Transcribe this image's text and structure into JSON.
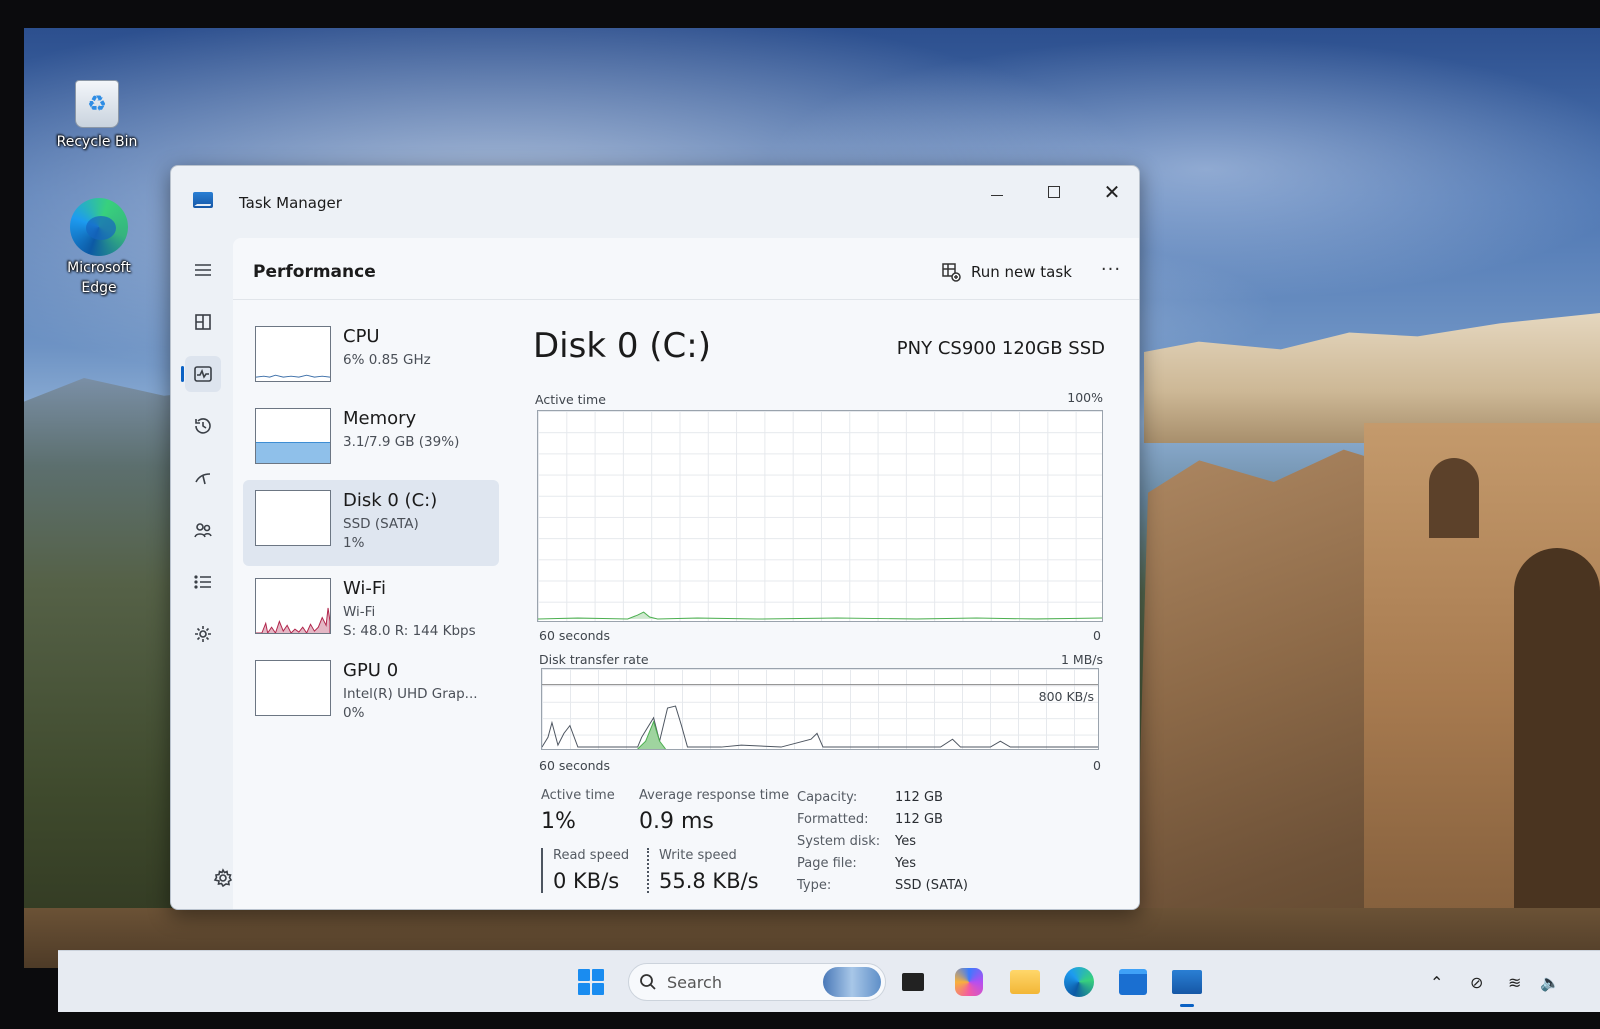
{
  "desktop": {
    "icons": [
      {
        "label": "Recycle Bin",
        "icon": "recycle-bin-icon"
      },
      {
        "label": "Microsoft Edge",
        "icon": "edge-icon"
      }
    ]
  },
  "window": {
    "title": "Task Manager",
    "controls": {
      "minimize": "minimize",
      "maximize": "maximize",
      "close": "close"
    }
  },
  "nav": [
    {
      "name": "hamburger-menu-icon"
    },
    {
      "name": "processes-icon"
    },
    {
      "name": "performance-icon",
      "active": true
    },
    {
      "name": "app-history-icon"
    },
    {
      "name": "startup-apps-icon"
    },
    {
      "name": "users-icon"
    },
    {
      "name": "details-icon"
    },
    {
      "name": "services-icon"
    },
    {
      "name": "settings-icon"
    }
  ],
  "header": {
    "title": "Performance",
    "run_new_task": "Run new task",
    "more": "···"
  },
  "devices": [
    {
      "name": "CPU",
      "line1": "6% 0.85 GHz",
      "line2": ""
    },
    {
      "name": "Memory",
      "line1": "3.1/7.9 GB (39%)",
      "line2": "",
      "usage": 0.39
    },
    {
      "name": "Disk 0 (C:)",
      "line1": "SSD (SATA)",
      "line2": "1%",
      "selected": true
    },
    {
      "name": "Wi-Fi",
      "line1": "Wi-Fi",
      "line2": "S: 48.0  R: 144 Kbps"
    },
    {
      "name": "GPU 0",
      "line1": "Intel(R) UHD Grap...",
      "line2": "0%"
    }
  ],
  "detail": {
    "title": "Disk 0 (C:)",
    "model": "PNY CS900 120GB SSD",
    "active_time_label": "Active time",
    "active_time_max": "100%",
    "active_time_span": "60 seconds",
    "active_time_min": "0",
    "transfer_label": "Disk transfer rate",
    "transfer_max": "1 MB/s",
    "transfer_line": "800 KB/s",
    "transfer_span": "60 seconds",
    "transfer_min": "0",
    "stats": {
      "active_time_k": "Active time",
      "active_time_v": "1%",
      "avg_resp_k": "Average response time",
      "avg_resp_v": "0.9 ms",
      "read_k": "Read speed",
      "read_v": "0 KB/s",
      "write_k": "Write speed",
      "write_v": "55.8 KB/s"
    },
    "props": [
      {
        "k": "Capacity:",
        "v": "112 GB"
      },
      {
        "k": "Formatted:",
        "v": "112 GB"
      },
      {
        "k": "System disk:",
        "v": "Yes"
      },
      {
        "k": "Page file:",
        "v": "Yes"
      },
      {
        "k": "Type:",
        "v": "SSD (SATA)"
      }
    ]
  },
  "taskbar": {
    "search_placeholder": "Search"
  },
  "colors": {
    "accent": "#0a61c4",
    "disk_graph": "#4caf50",
    "memory_fill": "#8fc0ea",
    "wifi_graph": "#b0244a"
  }
}
